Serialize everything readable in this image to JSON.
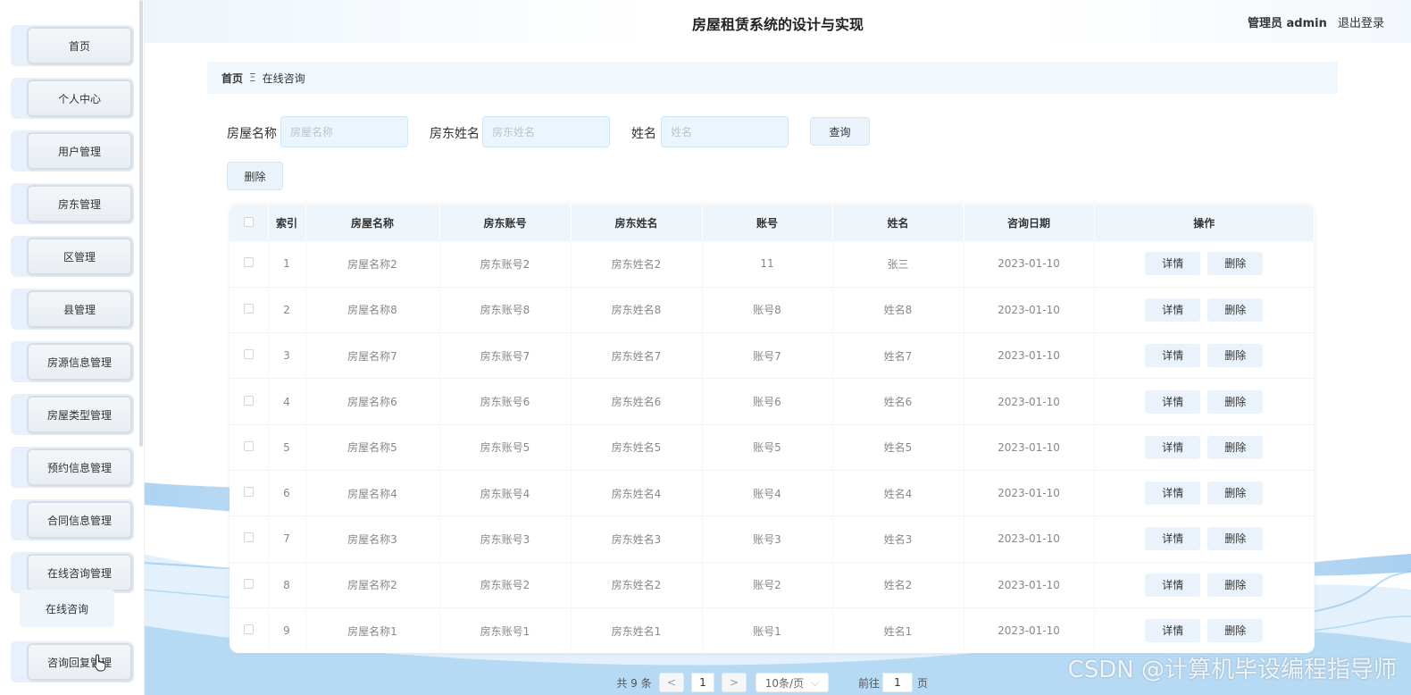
{
  "header": {
    "title": "房屋租赁系统的设计与实现",
    "user": "管理员 admin",
    "logout": "退出登录"
  },
  "sidebar": {
    "items": [
      {
        "label": "首页"
      },
      {
        "label": "个人中心"
      },
      {
        "label": "用户管理"
      },
      {
        "label": "房东管理"
      },
      {
        "label": "区管理"
      },
      {
        "label": "县管理"
      },
      {
        "label": "房源信息管理"
      },
      {
        "label": "房屋类型管理"
      },
      {
        "label": "预约信息管理"
      },
      {
        "label": "合同信息管理"
      },
      {
        "label": "在线咨询管理"
      },
      {
        "label": "咨询回复管理"
      }
    ],
    "submenu": {
      "label": "在线咨询"
    }
  },
  "breadcrumb": {
    "home": "首页",
    "separator": "Ξ",
    "current": "在线咨询"
  },
  "search": {
    "fields": [
      {
        "label": "房屋名称",
        "placeholder": "房屋名称",
        "value": ""
      },
      {
        "label": "房东姓名",
        "placeholder": "房东姓名",
        "value": ""
      },
      {
        "label": "姓名",
        "placeholder": "姓名",
        "value": ""
      }
    ],
    "query_button": "查询",
    "delete_button": "删除"
  },
  "table": {
    "columns": [
      "索引",
      "房屋名称",
      "房东账号",
      "房东姓名",
      "账号",
      "姓名",
      "咨询日期",
      "操作"
    ],
    "detail_label": "详情",
    "delete_label": "删除",
    "rows": [
      {
        "index": "1",
        "house": "房屋名称2",
        "landlord_account": "房东账号2",
        "landlord_name": "房东姓名2",
        "account": "11",
        "name": "张三",
        "date": "2023-01-10"
      },
      {
        "index": "2",
        "house": "房屋名称8",
        "landlord_account": "房东账号8",
        "landlord_name": "房东姓名8",
        "account": "账号8",
        "name": "姓名8",
        "date": "2023-01-10"
      },
      {
        "index": "3",
        "house": "房屋名称7",
        "landlord_account": "房东账号7",
        "landlord_name": "房东姓名7",
        "account": "账号7",
        "name": "姓名7",
        "date": "2023-01-10"
      },
      {
        "index": "4",
        "house": "房屋名称6",
        "landlord_account": "房东账号6",
        "landlord_name": "房东姓名6",
        "account": "账号6",
        "name": "姓名6",
        "date": "2023-01-10"
      },
      {
        "index": "5",
        "house": "房屋名称5",
        "landlord_account": "房东账号5",
        "landlord_name": "房东姓名5",
        "account": "账号5",
        "name": "姓名5",
        "date": "2023-01-10"
      },
      {
        "index": "6",
        "house": "房屋名称4",
        "landlord_account": "房东账号4",
        "landlord_name": "房东姓名4",
        "account": "账号4",
        "name": "姓名4",
        "date": "2023-01-10"
      },
      {
        "index": "7",
        "house": "房屋名称3",
        "landlord_account": "房东账号3",
        "landlord_name": "房东姓名3",
        "account": "账号3",
        "name": "姓名3",
        "date": "2023-01-10"
      },
      {
        "index": "8",
        "house": "房屋名称2",
        "landlord_account": "房东账号2",
        "landlord_name": "房东姓名2",
        "account": "账号2",
        "name": "姓名2",
        "date": "2023-01-10"
      },
      {
        "index": "9",
        "house": "房屋名称1",
        "landlord_account": "房东账号1",
        "landlord_name": "房东姓名1",
        "account": "账号1",
        "name": "姓名1",
        "date": "2023-01-10"
      }
    ]
  },
  "pagination": {
    "total": "共 9 条",
    "prev": "<",
    "page": "1",
    "next": ">",
    "page_size": "10条/页",
    "goto_label": "前往",
    "goto_value": "1",
    "page_suffix": "页"
  },
  "watermark": "CSDN @计算机毕设编程指导师",
  "colors": {
    "accent": "#eaf3fb",
    "header_bg": "#eef6fc",
    "wave": "#8cc3ee"
  }
}
